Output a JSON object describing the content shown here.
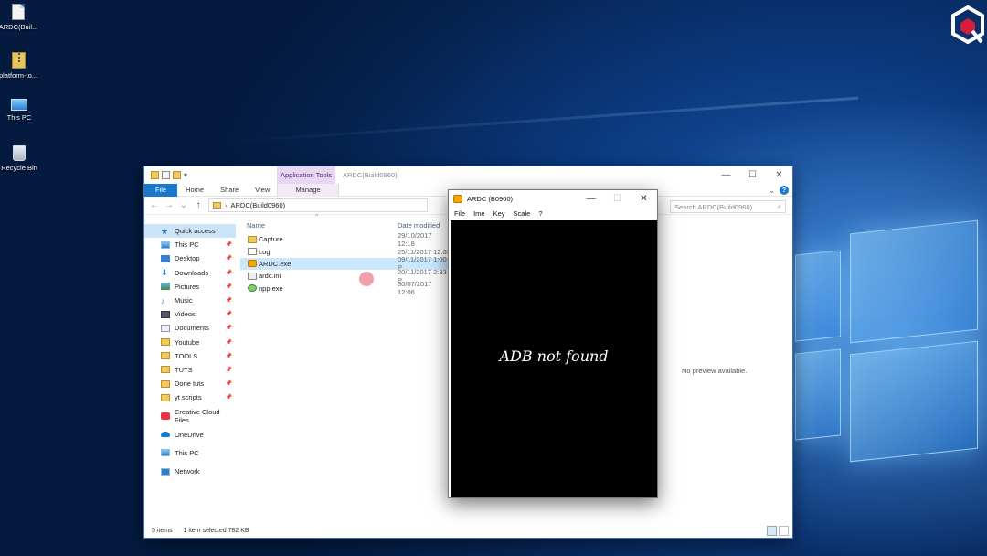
{
  "desktop": {
    "icons": [
      {
        "label": "ARDC(Buil..."
      },
      {
        "label": "platform-to..."
      },
      {
        "label": "This PC"
      },
      {
        "label": "Recycle Bin"
      }
    ]
  },
  "explorer": {
    "context_tab": "Application Tools",
    "title": "ARDC(Build0960)",
    "ribbon_tabs": [
      "File",
      "Home",
      "Share",
      "View"
    ],
    "manage_tab": "Manage",
    "address": "ARDC(Build0960)",
    "search_placeholder": "Search ARDC(Build0960)",
    "columns": {
      "name": "Name",
      "date": "Date modified"
    },
    "nav": {
      "quick_access": "Quick access",
      "items": [
        "This PC",
        "Desktop",
        "Downloads",
        "Pictures",
        "Music",
        "Videos",
        "Documents",
        "Youtube",
        "TOOLS",
        "TUTS",
        "Done tuts",
        "yt scripts"
      ],
      "creative_cloud": "Creative Cloud Files",
      "onedrive": "OneDrive",
      "this_pc": "This PC",
      "network": "Network"
    },
    "files": [
      {
        "name": "Capture",
        "date": "29/10/2017 12:18"
      },
      {
        "name": "Log",
        "date": "25/11/2017 12:03"
      },
      {
        "name": "ARDC.exe",
        "date": "09/11/2017 1:00 P"
      },
      {
        "name": "ardc.ini",
        "date": "20/11/2017 2:33 P"
      },
      {
        "name": "npp.exe",
        "date": "30/07/2017 12:06"
      }
    ],
    "preview_text": "No preview available.",
    "status": {
      "count": "5 items",
      "selected": "1 item selected  782 KB"
    }
  },
  "ardc": {
    "title": "ARDC (B0960)",
    "menu": [
      "File",
      "Ime",
      "Key",
      "Scale",
      "?"
    ],
    "message": "ADB not found"
  }
}
